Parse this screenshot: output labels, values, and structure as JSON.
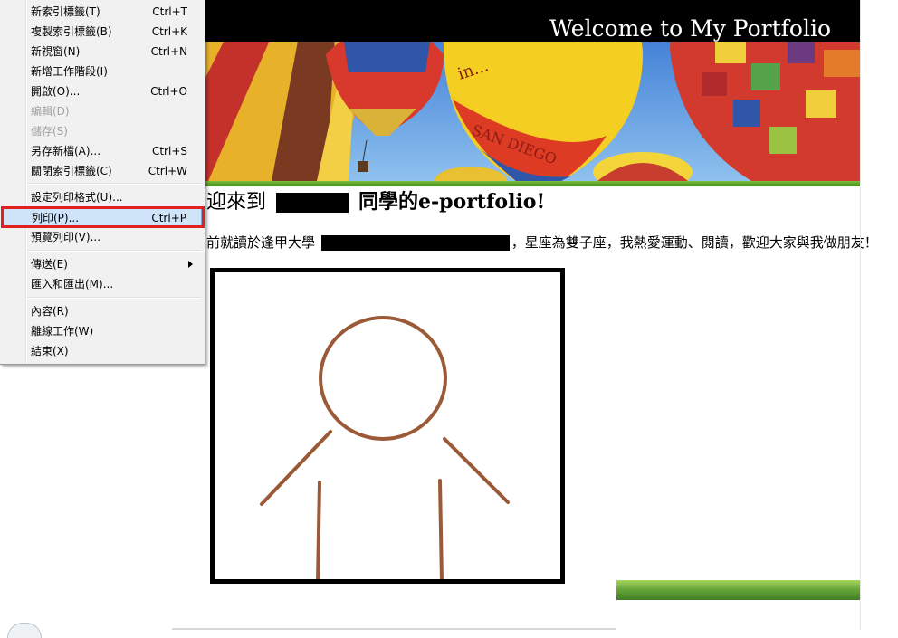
{
  "banner": {
    "title": "Welcome to My Portfolio",
    "balloon_text_1": "in...",
    "balloon_text_2": "SAN DIEGO"
  },
  "heading": {
    "prefix": "迎來到",
    "suffix": "同學的e-portfolio!"
  },
  "intro": {
    "prefix": "前就讀於逢甲大學",
    "suffix": "，星座為雙子座，我熱愛運動、閱讀，歡迎大家與我做朋友！"
  },
  "menu": {
    "items": [
      {
        "label": "新索引標籤(T)",
        "shortcut": "Ctrl+T",
        "disabled": false
      },
      {
        "label": "複製索引標籤(B)",
        "shortcut": "Ctrl+K",
        "disabled": false
      },
      {
        "label": "新視窗(N)",
        "shortcut": "Ctrl+N",
        "disabled": false
      },
      {
        "label": "新增工作階段(I)",
        "shortcut": "",
        "disabled": false
      },
      {
        "label": "開啟(O)...",
        "shortcut": "Ctrl+O",
        "disabled": false
      },
      {
        "label": "編輯(D)",
        "shortcut": "",
        "disabled": true
      },
      {
        "label": "儲存(S)",
        "shortcut": "",
        "disabled": true
      },
      {
        "label": "另存新檔(A)...",
        "shortcut": "Ctrl+S",
        "disabled": false
      },
      {
        "label": "關閉索引標籤(C)",
        "shortcut": "Ctrl+W",
        "disabled": false
      },
      {
        "label": "設定列印格式(U)...",
        "shortcut": "",
        "disabled": false
      },
      {
        "label": "列印(P)...",
        "shortcut": "Ctrl+P",
        "disabled": false,
        "selected": true
      },
      {
        "label": "預覽列印(V)...",
        "shortcut": "",
        "disabled": false
      },
      {
        "label": "傳送(E)",
        "shortcut": "",
        "disabled": false,
        "submenu": true
      },
      {
        "label": "匯入和匯出(M)...",
        "shortcut": "",
        "disabled": false
      },
      {
        "label": "內容(R)",
        "shortcut": "",
        "disabled": false
      },
      {
        "label": "離線工作(W)",
        "shortcut": "",
        "disabled": false
      },
      {
        "label": "結束(X)",
        "shortcut": "",
        "disabled": false
      }
    ]
  },
  "colors": {
    "highlight": "#e0201f",
    "menu_selected": "#cfe3f9",
    "figure_stroke": "#9b5a37",
    "green_bar": "#6aa83a"
  },
  "icons": [
    "submenu-arrow-icon",
    "globe-icon"
  ]
}
